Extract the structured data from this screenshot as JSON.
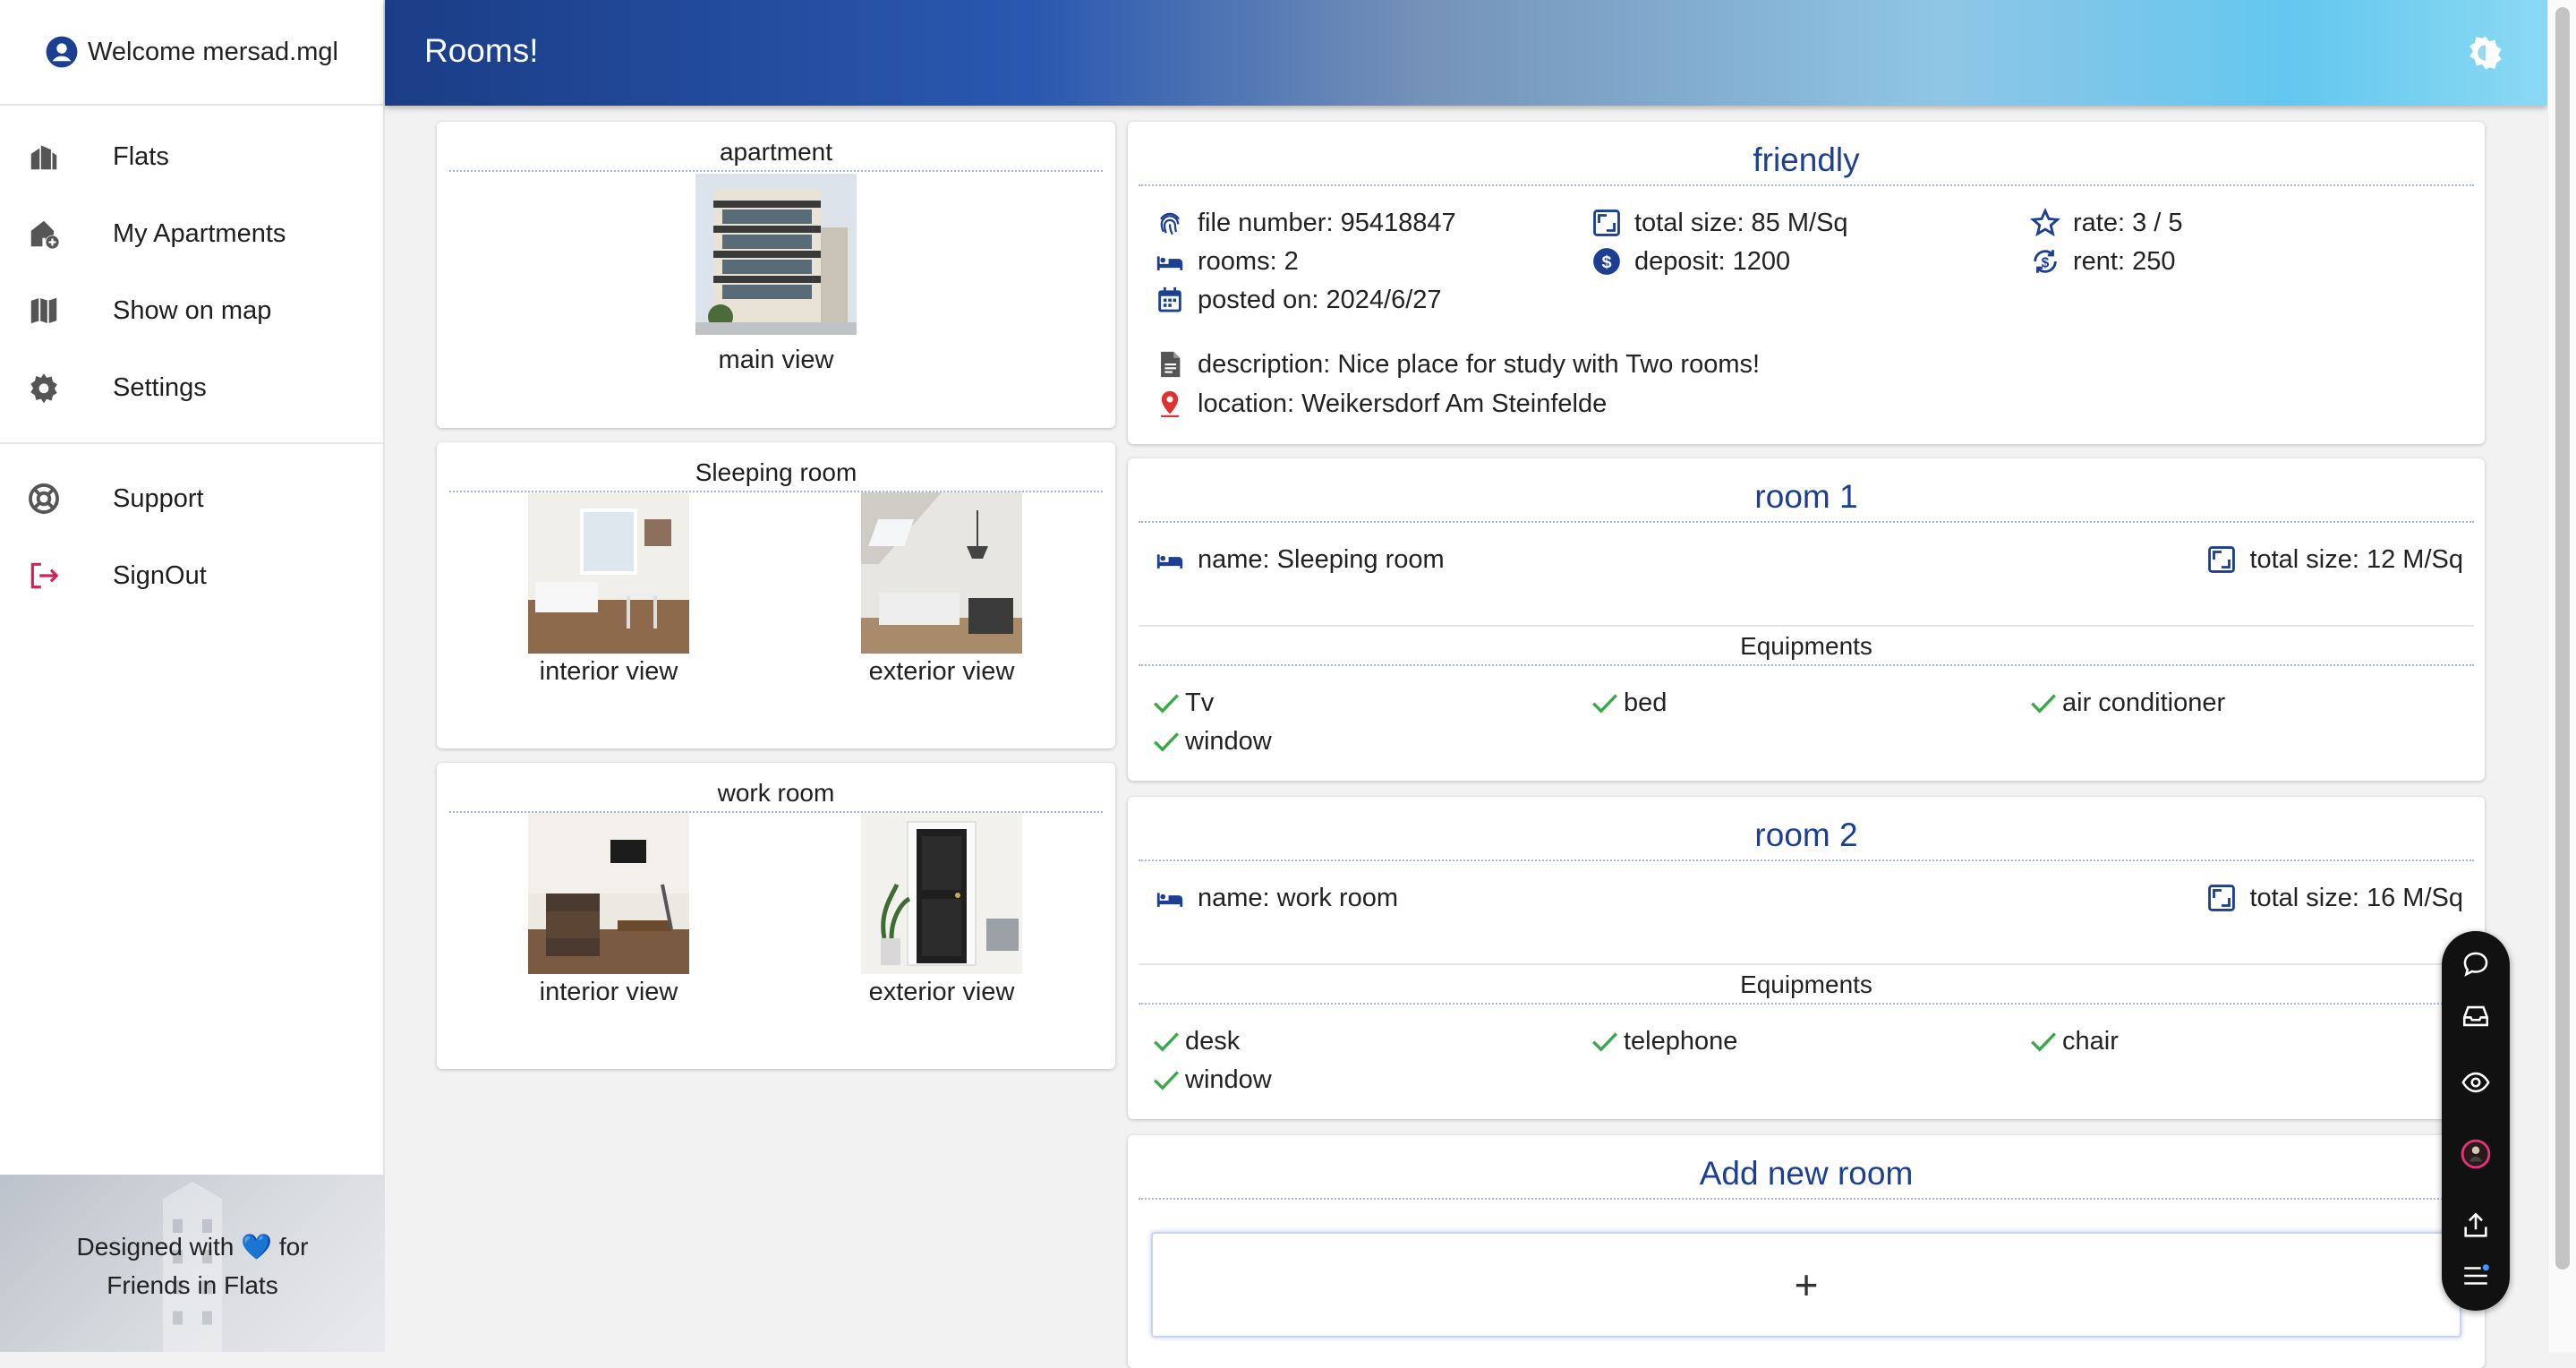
{
  "sidebar": {
    "welcome": "Welcome mersad.mgl",
    "items": [
      {
        "label": "Flats",
        "icon": "buildings-icon"
      },
      {
        "label": "My Apartments",
        "icon": "house-add-icon"
      },
      {
        "label": "Show on map",
        "icon": "map-icon"
      },
      {
        "label": "Settings",
        "icon": "gear-icon"
      },
      {
        "label": "Support",
        "icon": "lifebuoy-icon"
      },
      {
        "label": "SignOut",
        "icon": "signout-icon"
      }
    ],
    "footer": {
      "line1_pre": "Designed with",
      "heart": "💙",
      "line1_post": "for",
      "line2": "Friends in Flats"
    }
  },
  "header": {
    "title": "Rooms!"
  },
  "gallery": [
    {
      "title": "apartment",
      "photos": [
        {
          "caption": "main view"
        }
      ]
    },
    {
      "title": "Sleeping room",
      "photos": [
        {
          "caption": "interior view"
        },
        {
          "caption": "exterior view"
        }
      ]
    },
    {
      "title": "work room",
      "photos": [
        {
          "caption": "interior view"
        },
        {
          "caption": "exterior view"
        }
      ]
    }
  ],
  "flat": {
    "title": "friendly",
    "file_number": "file number: 95418847",
    "total_size": "total size: 85 M/Sq",
    "rate": "rate: 3 / 5",
    "rooms": "rooms: 2",
    "deposit": "deposit: 1200",
    "rent": "rent: 250",
    "posted_on": "posted on: 2024/6/27",
    "description": "description: Nice place for study with Two rooms!",
    "location": "location: Weikersdorf Am Steinfelde"
  },
  "rooms": [
    {
      "title": "room 1",
      "name": "name: Sleeping room",
      "total_size": "total size: 12 M/Sq",
      "equipments_title": "Equipments",
      "equipments": [
        "Tv",
        "bed",
        "air conditioner",
        "window"
      ]
    },
    {
      "title": "room 2",
      "name": "name: work room",
      "total_size": "total size: 16 M/Sq",
      "equipments_title": "Equipments",
      "equipments": [
        "desk",
        "telephone",
        "chair",
        "window"
      ]
    }
  ],
  "add_room": {
    "title": "Add new room",
    "plus": "+"
  },
  "colors": {
    "accent": "#1c3f92",
    "check": "#3aa84a",
    "signout": "#d0215c"
  }
}
